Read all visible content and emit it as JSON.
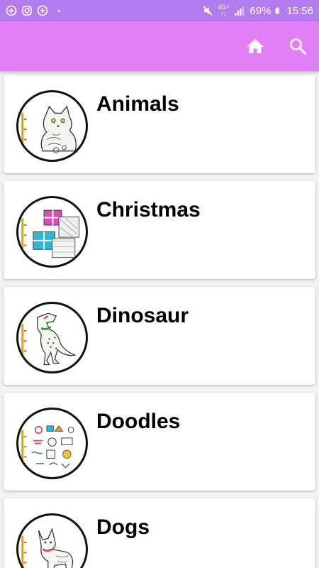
{
  "status_bar": {
    "battery": "69%",
    "time": "15:56",
    "network": "4G+",
    "background_color": "#b27bf0",
    "left_icons": [
      "add-circle-icon",
      "instagram-icon",
      "add-circle-icon"
    ],
    "right_icons": [
      "mute-icon",
      "signal-icon",
      "battery-icon"
    ]
  },
  "app_bar": {
    "background_color": "#e37ef7",
    "actions": [
      {
        "name": "home",
        "icon": "home-icon"
      },
      {
        "name": "search",
        "icon": "search-icon"
      }
    ]
  },
  "categories": [
    {
      "title": "Animals",
      "thumbnail": "cat-illustration"
    },
    {
      "title": "Christmas",
      "thumbnail": "gift-boxes-illustration"
    },
    {
      "title": "Dinosaur",
      "thumbnail": "dinosaur-illustration"
    },
    {
      "title": "Doodles",
      "thumbnail": "doodles-illustration"
    },
    {
      "title": "Dogs",
      "thumbnail": "dog-illustration"
    }
  ]
}
